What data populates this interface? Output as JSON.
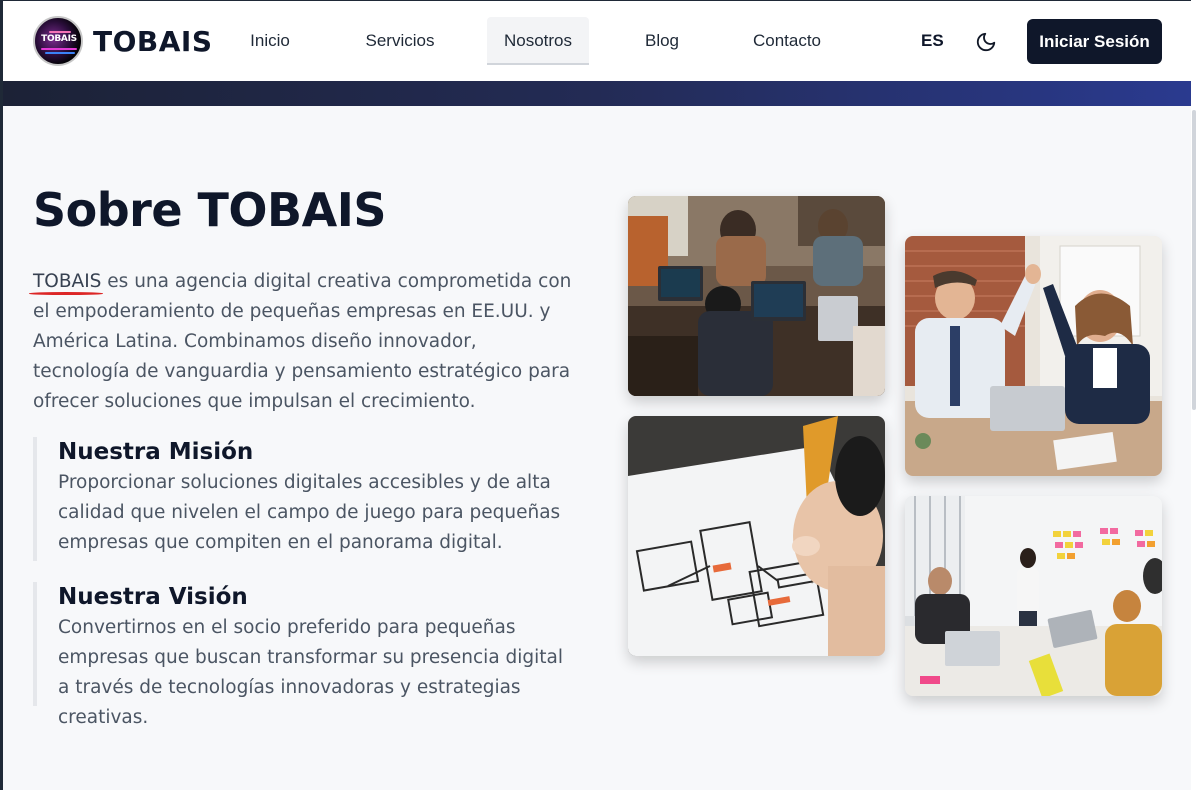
{
  "brand": {
    "logo_text": "TOBAIS",
    "name": "TOBAIS"
  },
  "nav": {
    "items": [
      {
        "label": "Inicio"
      },
      {
        "label": "Servicios"
      },
      {
        "label": "Nosotros",
        "active": true
      },
      {
        "label": "Blog"
      },
      {
        "label": "Contacto"
      }
    ]
  },
  "header": {
    "language": "ES",
    "theme_icon": "moon-icon",
    "login_label": "Iniciar Sesión"
  },
  "about": {
    "title": "Sobre TOBAIS",
    "intro_brand": "TOBAIS",
    "intro_rest": " es una agencia digital creativa comprometida con el empoderamiento de pequeñas empresas en EE.UU. y América Latina. Combinamos diseño innovador, tecnología de vanguardia y pensamiento estratégico para ofrecer soluciones que impulsan el crecimiento.",
    "mission": {
      "title": "Nuestra Misión",
      "text": "Proporcionar soluciones digitales accesibles y de alta calidad que nivelen el campo de juego para pequeñas empresas que compiten en el panorama digital."
    },
    "vision": {
      "title": "Nuestra Visión",
      "text": "Convertirnos en el socio preferido para pequeñas empresas que buscan transformar su presencia digital a través de tecnologías innovadoras y estrategias creativas."
    }
  },
  "colors": {
    "primary": "#0f172a",
    "accent_underline": "#dc2626",
    "body_text": "#4b5563",
    "hero_strip": "#2a3a8f"
  }
}
